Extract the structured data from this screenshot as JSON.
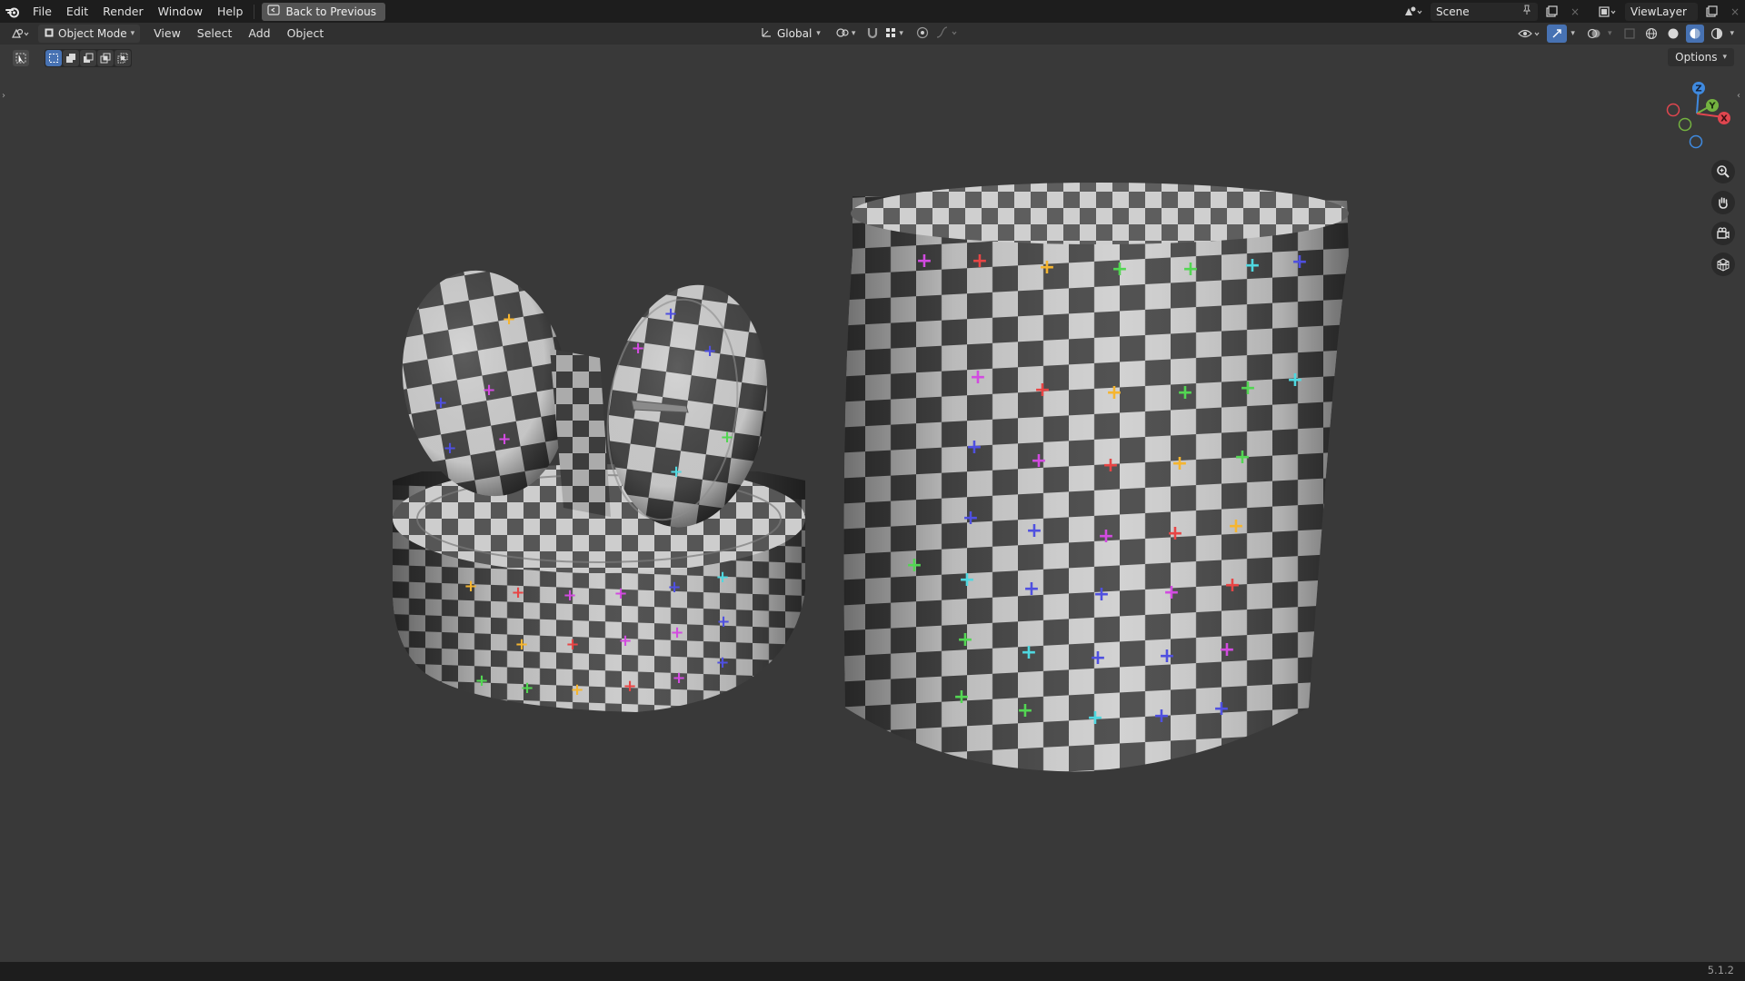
{
  "topbar": {
    "menus": [
      "File",
      "Edit",
      "Render",
      "Window",
      "Help"
    ],
    "back_button": "Back to Previous",
    "scene_name": "Scene",
    "view_layer": "ViewLayer"
  },
  "header": {
    "mode": "Object Mode",
    "menus": [
      "View",
      "Select",
      "Add",
      "Object"
    ],
    "transform_orientation": "Global"
  },
  "viewport": {
    "options_label": "Options",
    "gizmo_axes": [
      "Z",
      "Y",
      "X"
    ]
  },
  "status": {
    "version": "5.1.2"
  },
  "icons": {
    "logo": "blender-logo",
    "back": "back-icon",
    "scene": "scene-icon",
    "pin": "pin-icon",
    "new_scene": "new-scene-icon",
    "zoom": "zoom-icon",
    "pan": "hand-icon",
    "camera": "camera-icon",
    "ortho": "grid-icon"
  },
  "colors": {
    "accent_blue": "#4772b3",
    "axis_x": "#e0464f",
    "axis_y": "#74b340",
    "axis_z": "#3f8ae0"
  }
}
